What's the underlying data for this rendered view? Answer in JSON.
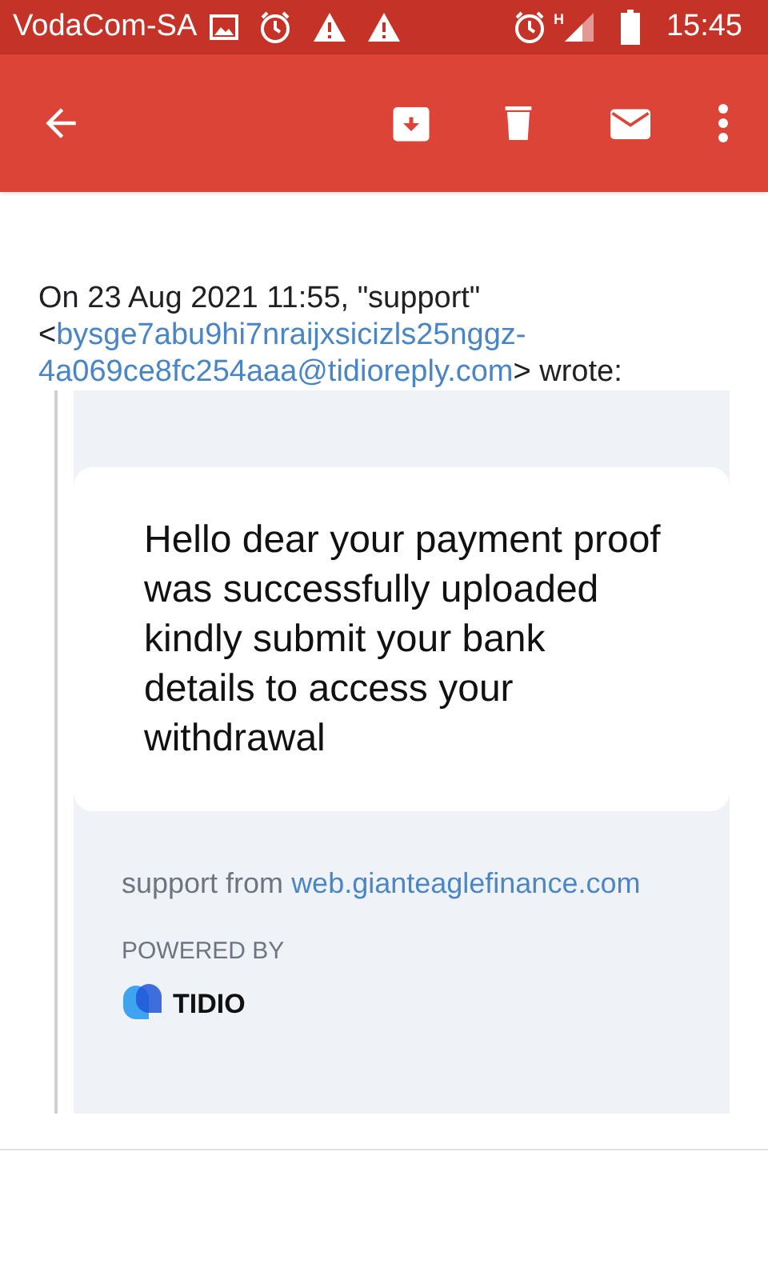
{
  "status_bar": {
    "carrier": "VodaCom-SA",
    "network_type": "H",
    "time": "15:45"
  },
  "header": {
    "date_line": "On 23 Aug 2021 11:55, \"support\"",
    "open_bracket": "<",
    "sender_email": "bysge7abu9hi7nraijxsicizls25nggz-4a069ce8fc254aaa@tidioreply.com",
    "close_text": "> wrote:"
  },
  "quoted": {
    "message": "Hello dear your payment proof was successfully uploaded kindly submit your bank details to access your withdrawal",
    "support_prefix": "support from",
    "support_link": "web.gianteaglefinance.com",
    "powered_by": "POWERED BY",
    "brand": "TIDIO"
  }
}
